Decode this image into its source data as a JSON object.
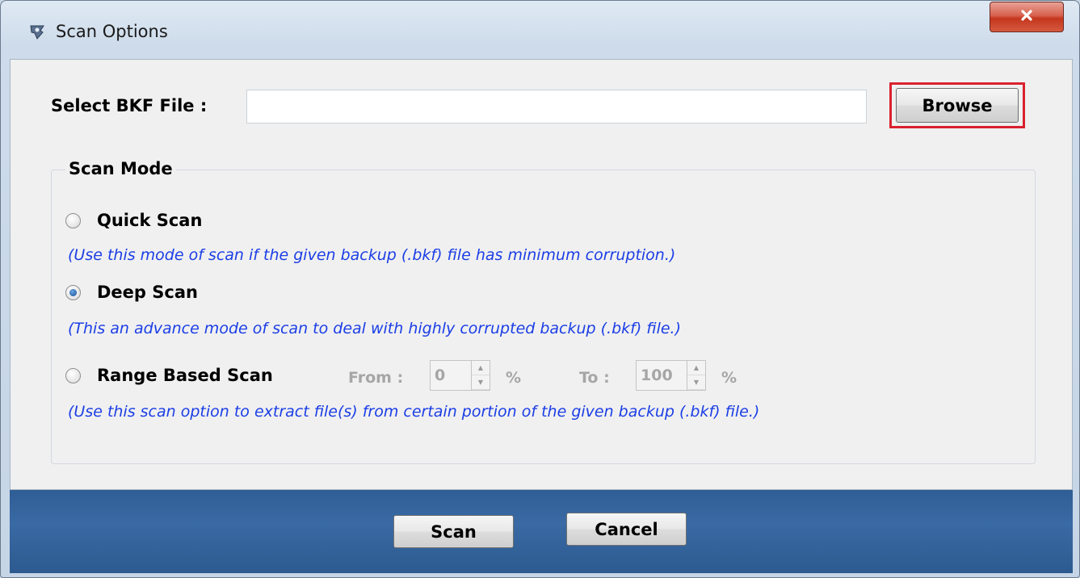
{
  "window": {
    "title": "Scan Options",
    "close_symbol": "x"
  },
  "file_select": {
    "label": "Select BKF File :",
    "value": "",
    "placeholder": "",
    "browse_label": "Browse"
  },
  "scan_mode": {
    "legend": "Scan Mode",
    "options": [
      {
        "label": "Quick Scan",
        "checked": false,
        "description": "(Use this mode of scan if the given backup (.bkf) file has minimum corruption.)"
      },
      {
        "label": "Deep Scan",
        "checked": true,
        "description": "(This an advance mode of scan to deal with highly corrupted backup (.bkf) file.)"
      },
      {
        "label": "Range Based Scan",
        "checked": false,
        "description": "(Use this scan option to extract file(s) from certain portion of the given backup (.bkf) file.)"
      }
    ],
    "range": {
      "from_label": "From :",
      "from_value": "0",
      "to_label": "To :",
      "to_value": "100",
      "unit": "%"
    }
  },
  "footer": {
    "scan_label": "Scan",
    "cancel_label": "Cancel"
  },
  "colors": {
    "description_text": "#1b3ee6",
    "highlight_border": "#d9222e",
    "footer_bar": "#34649c"
  },
  "icons": {
    "app": "app-logo-icon",
    "close": "close-icon"
  }
}
